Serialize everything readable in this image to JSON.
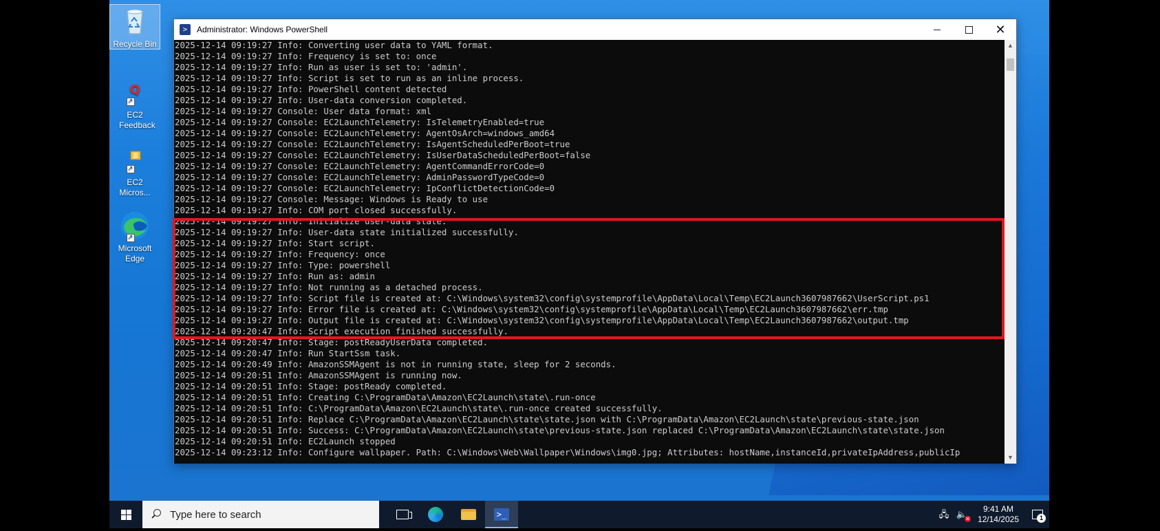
{
  "desktop": {
    "icons": [
      {
        "label": "Recycle Bin",
        "icon": "recycle-bin-icon"
      },
      {
        "label": "EC2 Feedback",
        "icon": "ec2-feedback-icon"
      },
      {
        "label": "EC2 Micros...",
        "icon": "ec2-microsoft-icon"
      },
      {
        "label": "Microsoft Edge",
        "icon": "edge-icon"
      }
    ]
  },
  "window": {
    "title": "Administrator: Windows PowerShell",
    "console_lines": [
      "2025-12-14 09:19:27 Info: Converting user data to YAML format.",
      "2025-12-14 09:19:27 Info: Frequency is set to: once",
      "2025-12-14 09:19:27 Info: Run as user is set to: 'admin'.",
      "2025-12-14 09:19:27 Info: Script is set to run as an inline process.",
      "2025-12-14 09:19:27 Info: PowerShell content detected",
      "2025-12-14 09:19:27 Info: User-data conversion completed.",
      "2025-12-14 09:19:27 Console: User data format: xml",
      "2025-12-14 09:19:27 Console: EC2LaunchTelemetry: IsTelemetryEnabled=true",
      "2025-12-14 09:19:27 Console: EC2LaunchTelemetry: AgentOsArch=windows_amd64",
      "2025-12-14 09:19:27 Console: EC2LaunchTelemetry: IsAgentScheduledPerBoot=true",
      "2025-12-14 09:19:27 Console: EC2LaunchTelemetry: IsUserDataScheduledPerBoot=false",
      "2025-12-14 09:19:27 Console: EC2LaunchTelemetry: AgentCommandErrorCode=0",
      "2025-12-14 09:19:27 Console: EC2LaunchTelemetry: AdminPasswordTypeCode=0",
      "2025-12-14 09:19:27 Console: EC2LaunchTelemetry: IpConflictDetectionCode=0",
      "2025-12-14 09:19:27 Console: Message: Windows is Ready to use",
      "2025-12-14 09:19:27 Info: COM port closed successfully.",
      "2025-12-14 09:19:27 Info: Initialize user-data state.",
      "2025-12-14 09:19:27 Info: User-data state initialized successfully.",
      "2025-12-14 09:19:27 Info: Start script.",
      "2025-12-14 09:19:27 Info: Frequency: once",
      "2025-12-14 09:19:27 Info: Type: powershell",
      "2025-12-14 09:19:27 Info: Run as: admin",
      "2025-12-14 09:19:27 Info: Not running as a detached process.",
      "2025-12-14 09:19:27 Info: Script file is created at: C:\\Windows\\system32\\config\\systemprofile\\AppData\\Local\\Temp\\EC2Launch3607987662\\UserScript.ps1",
      "2025-12-14 09:19:27 Info: Error file is created at: C:\\Windows\\system32\\config\\systemprofile\\AppData\\Local\\Temp\\EC2Launch3607987662\\err.tmp",
      "2025-12-14 09:19:27 Info: Output file is created at: C:\\Windows\\system32\\config\\systemprofile\\AppData\\Local\\Temp\\EC2Launch3607987662\\output.tmp",
      "2025-12-14 09:20:47 Info: Script execution finished successfully.",
      "2025-12-14 09:20:47 Info: Stage: postReadyUserData completed.",
      "2025-12-14 09:20:47 Info: Run StartSsm task.",
      "2025-12-14 09:20:49 Info: AmazonSSMAgent is not in running state, sleep for 2 seconds.",
      "2025-12-14 09:20:51 Info: AmazonSSMAgent is running now.",
      "2025-12-14 09:20:51 Info: Stage: postReady completed.",
      "2025-12-14 09:20:51 Info: Creating C:\\ProgramData\\Amazon\\EC2Launch\\state\\.run-once",
      "2025-12-14 09:20:51 Info: C:\\ProgramData\\Amazon\\EC2Launch\\state\\.run-once created successfully.",
      "2025-12-14 09:20:51 Info: Replace C:\\ProgramData\\Amazon\\EC2Launch\\state\\state.json with C:\\ProgramData\\Amazon\\EC2Launch\\state\\previous-state.json",
      "2025-12-14 09:20:51 Info: Success: C:\\ProgramData\\Amazon\\EC2Launch\\state\\previous-state.json replaced C:\\ProgramData\\Amazon\\EC2Launch\\state\\state.json",
      "2025-12-14 09:20:51 Info: EC2Launch stopped",
      "2025-12-14 09:23:12 Info: Configure wallpaper. Path: C:\\Windows\\Web\\Wallpaper\\Windows\\img0.jpg; Attributes: hostName,instanceId,privateIpAddress,publicIp"
    ]
  },
  "taskbar": {
    "search_placeholder": "Type here to search",
    "apps": [
      "task-view",
      "edge",
      "file-explorer",
      "powershell"
    ],
    "clock_time": "9:41 AM",
    "clock_date": "12/14/2025",
    "notification_count": "1"
  },
  "colors": {
    "highlight": "#e0181e",
    "console_bg": "#0c0c0c",
    "console_fg": "#cccccc"
  }
}
